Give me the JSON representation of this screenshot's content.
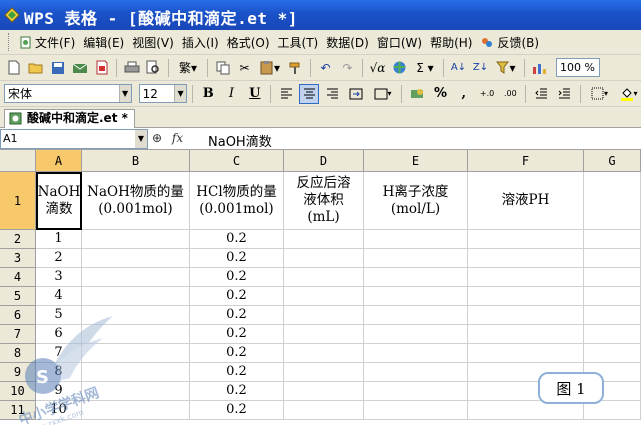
{
  "window": {
    "title": "WPS 表格 - [酸碱中和滴定.et *]"
  },
  "menu": {
    "items": [
      {
        "label": "文件(F)",
        "icon": "document-icon"
      },
      {
        "label": "编辑(E)"
      },
      {
        "label": "视图(V)"
      },
      {
        "label": "插入(I)"
      },
      {
        "label": "格式(O)"
      },
      {
        "label": "工具(T)"
      },
      {
        "label": "数据(D)"
      },
      {
        "label": "窗口(W)"
      },
      {
        "label": "帮助(H)"
      },
      {
        "label": "反馈(B)",
        "icon": "feedback-icon"
      }
    ]
  },
  "toolbar": {
    "zoom": "100 %"
  },
  "format": {
    "font_name": "宋体",
    "font_size": "12",
    "bold": "B",
    "italic": "I",
    "underline": "U",
    "percent": "%",
    "comma": ","
  },
  "doc_tab": {
    "label": "酸碱中和滴定.et *"
  },
  "formula_bar": {
    "name_box": "A1",
    "content": "NaOH滴数"
  },
  "columns": [
    "A",
    "B",
    "C",
    "D",
    "E",
    "F",
    "G"
  ],
  "selected_column": "A",
  "header_row": {
    "row": "1",
    "cells": [
      "NaOH\n滴数",
      "NaOH物质的量\n(0.001mol)",
      "HCl物质的量\n(0.001mol)",
      "反应后溶\n液体积\n(mL)",
      "H离子浓度\n(mol/L)",
      "溶液PH",
      ""
    ]
  },
  "rows": [
    {
      "row": "2",
      "a": "1",
      "c": "0.2"
    },
    {
      "row": "3",
      "a": "2",
      "c": "0.2"
    },
    {
      "row": "4",
      "a": "3",
      "c": "0.2"
    },
    {
      "row": "5",
      "a": "4",
      "c": "0.2"
    },
    {
      "row": "6",
      "a": "5",
      "c": "0.2"
    },
    {
      "row": "7",
      "a": "6",
      "c": "0.2"
    },
    {
      "row": "8",
      "a": "7",
      "c": "0.2"
    },
    {
      "row": "9",
      "a": "8",
      "c": "0.2"
    },
    {
      "row": "10",
      "a": "9",
      "c": "0.2"
    },
    {
      "row": "11",
      "a": "10",
      "c": "0.2"
    }
  ],
  "figure_label": "图 1",
  "watermark": {
    "brand": "中小学学科网",
    "url": "www.zxxk.com"
  },
  "colors": {
    "title_bar": "#1a52c8",
    "chrome": "#ece9d8",
    "selected_header": "#f8c96a",
    "figure_border": "#8fb0d8"
  }
}
